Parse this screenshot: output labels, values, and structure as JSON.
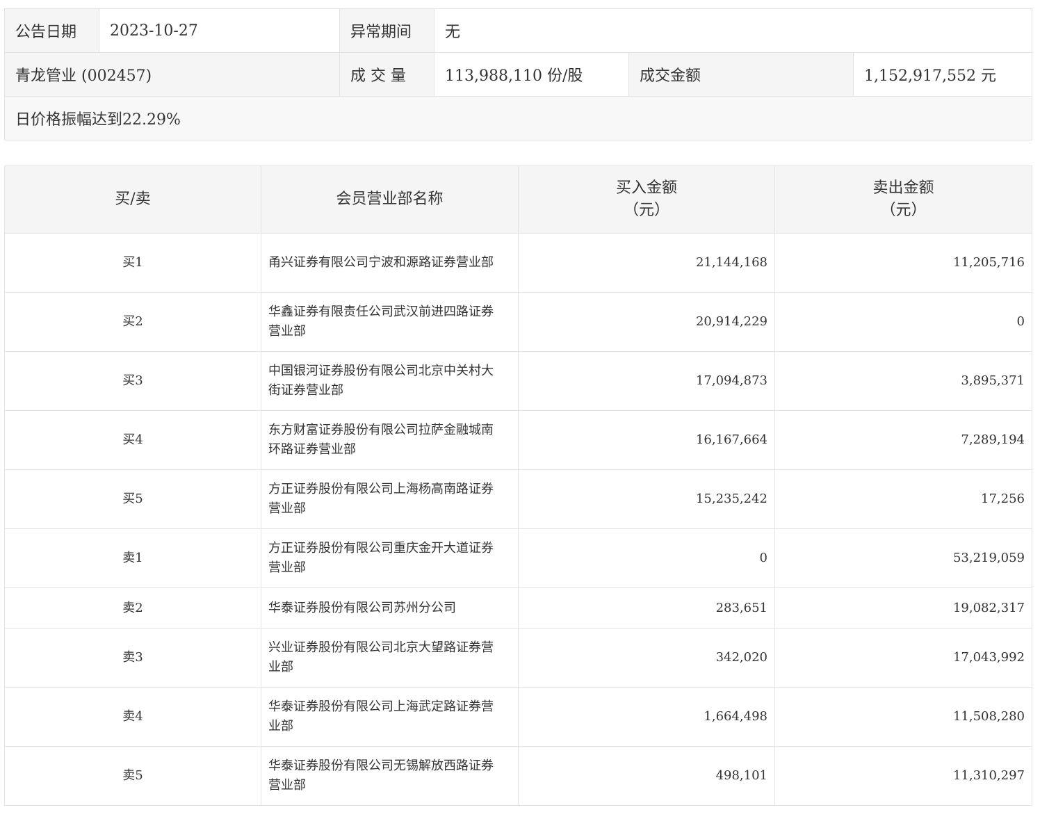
{
  "info": {
    "announce_date_label": "公告日期",
    "announce_date": "2023-10-27",
    "abnormal_period_label": "异常期间",
    "abnormal_period": "无",
    "stock": "青龙管业 (002457)",
    "volume_label": "成 交 量",
    "volume": "113,988,110 份/股",
    "turnover_label": "成交金额",
    "turnover": "1,152,917,552 元",
    "amplitude_note": "日价格振幅达到22.29%"
  },
  "table": {
    "headers": {
      "side": "买/卖",
      "member": "会员营业部名称",
      "buy_line1": "买入金额",
      "buy_line2": "（元）",
      "sell_line1": "卖出金额",
      "sell_line2": "（元）"
    },
    "rows": [
      {
        "side": "买1",
        "name": "甬兴证券有限公司宁波和源路证券营业部",
        "buy": "21,144,168",
        "sell": "11,205,716"
      },
      {
        "side": "买2",
        "name": "华鑫证券有限责任公司武汉前进四路证券营业部",
        "buy": "20,914,229",
        "sell": "0"
      },
      {
        "side": "买3",
        "name": "中国银河证券股份有限公司北京中关村大街证券营业部",
        "buy": "17,094,873",
        "sell": "3,895,371"
      },
      {
        "side": "买4",
        "name": "东方财富证券股份有限公司拉萨金融城南环路证券营业部",
        "buy": "16,167,664",
        "sell": "7,289,194"
      },
      {
        "side": "买5",
        "name": "方正证券股份有限公司上海杨高南路证券营业部",
        "buy": "15,235,242",
        "sell": "17,256"
      },
      {
        "side": "卖1",
        "name": "方正证券股份有限公司重庆金开大道证券营业部",
        "buy": "0",
        "sell": "53,219,059"
      },
      {
        "side": "卖2",
        "name": "华泰证券股份有限公司苏州分公司",
        "buy": "283,651",
        "sell": "19,082,317"
      },
      {
        "side": "卖3",
        "name": "兴业证券股份有限公司北京大望路证券营业部",
        "buy": "342,020",
        "sell": "17,043,992"
      },
      {
        "side": "卖4",
        "name": "华泰证券股份有限公司上海武定路证券营业部",
        "buy": "1,664,498",
        "sell": "11,508,280"
      },
      {
        "side": "卖5",
        "name": "华泰证券股份有限公司无锡解放西路证券营业部",
        "buy": "498,101",
        "sell": "11,310,297"
      }
    ]
  }
}
